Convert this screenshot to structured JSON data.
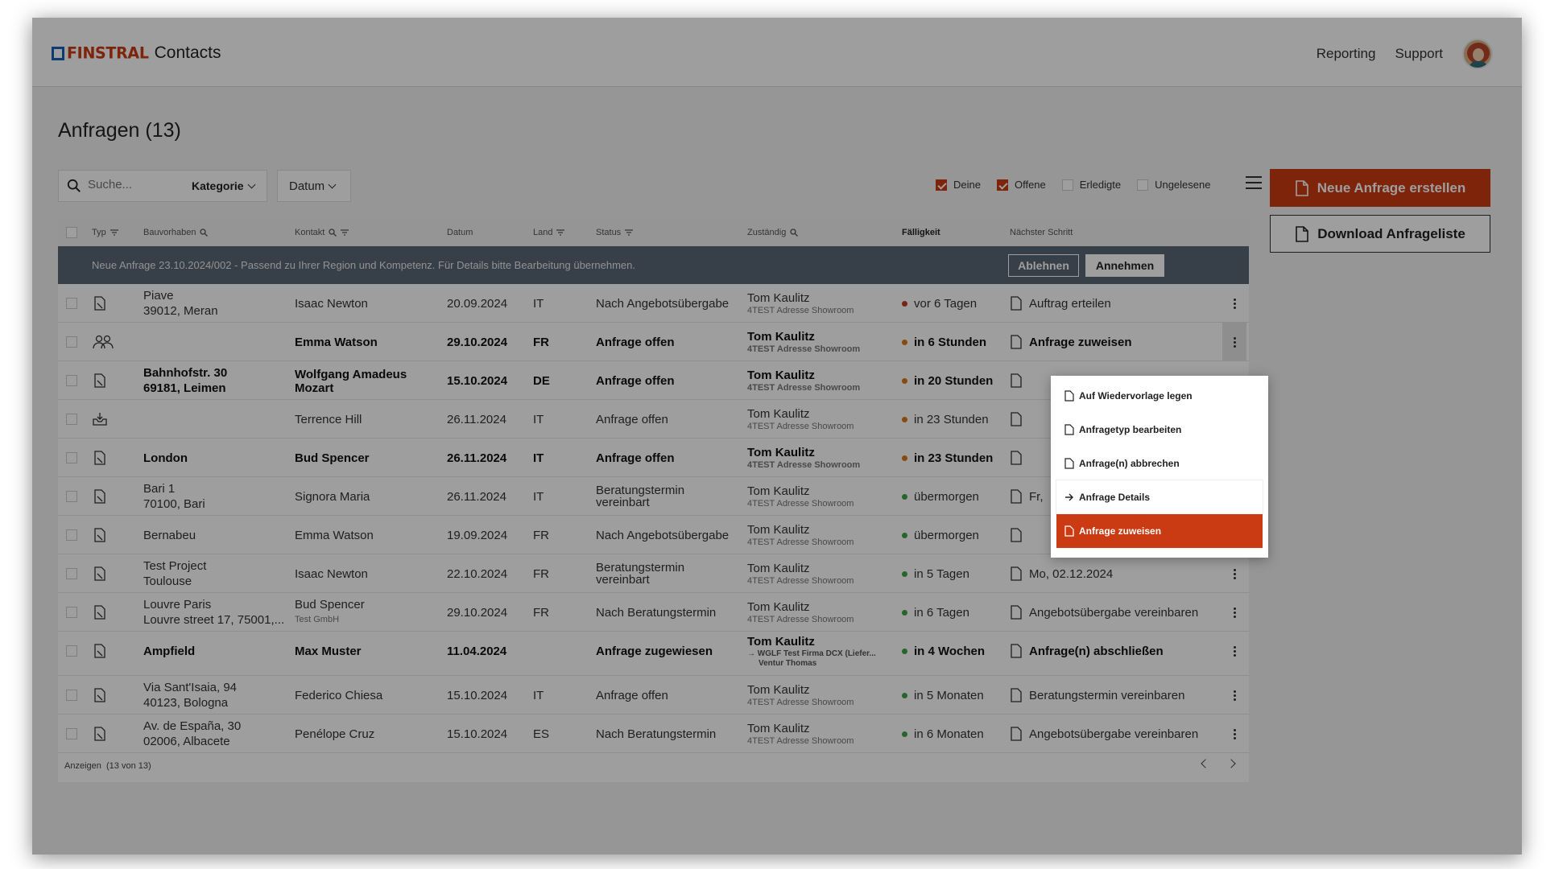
{
  "app": {
    "brand": "FINSTRAL",
    "product": "Contacts"
  },
  "topnav": {
    "reporting": "Reporting",
    "support": "Support"
  },
  "page": {
    "title": "Anfragen (13)"
  },
  "filterbar": {
    "search_placeholder": "Suche...",
    "category": "Kategorie",
    "date": "Datum",
    "filters": [
      {
        "label": "Deine",
        "checked": true
      },
      {
        "label": "Offene",
        "checked": true
      },
      {
        "label": "Erledigte",
        "checked": false
      },
      {
        "label": "Ungelesene",
        "checked": false
      }
    ]
  },
  "actions": {
    "new": "Neue Anfrage erstellen",
    "download": "Download Anfrageliste"
  },
  "table": {
    "headers": {
      "typ": "Typ",
      "bauvorhaben": "Bauvorhaben",
      "kontakt": "Kontakt",
      "datum": "Datum",
      "land": "Land",
      "status": "Status",
      "zustaendig": "Zuständig",
      "faelligkeit": "Fälligkeit",
      "next": "Nächster Schritt"
    },
    "banner": {
      "text": "Neue Anfrage 23.10.2024/002 - Passend zu Ihrer Region und Kompetenz. Für Details bitte Bearbeitung übernehmen.",
      "decline": "Ablehnen",
      "accept": "Annehmen"
    },
    "rows": [
      {
        "bold": false,
        "bau1": "Piave",
        "bau2": "39012, Meran",
        "kontakt": "Isaac Newton",
        "kontakt_sub": "",
        "datum": "20.09.2024",
        "land": "IT",
        "status1": "Nach Angebotsübergabe",
        "status2": "",
        "zust": "Tom Kaulitz",
        "zust_sub": "4TEST Adresse Showroom",
        "zust_sub2": "",
        "faell": "vor 6 Tagen",
        "dot": "red",
        "next": "Auftrag erteilen"
      },
      {
        "bold": true,
        "active": true,
        "bau1": "",
        "bau2": "",
        "kontakt": "Emma Watson",
        "kontakt_sub": "",
        "datum": "29.10.2024",
        "land": "FR",
        "status1": "Anfrage offen",
        "status2": "",
        "zust": "Tom Kaulitz",
        "zust_sub": "4TEST Adresse Showroom",
        "zust_sub2": "",
        "faell": "in 6 Stunden",
        "dot": "orange",
        "next": "Anfrage zuweisen"
      },
      {
        "bold": true,
        "bau1": "Bahnhofstr. 30",
        "bau2": "69181, Leimen",
        "kontakt": "Wolfgang Amadeus",
        "kontakt2": "Mozart",
        "kontakt_sub": "",
        "datum": "15.10.2024",
        "land": "DE",
        "status1": "Anfrage offen",
        "status2": "",
        "zust": "Tom Kaulitz",
        "zust_sub": "4TEST Adresse Showroom",
        "zust_sub2": "",
        "faell": "in 20 Stunden",
        "dot": "orange",
        "next": ""
      },
      {
        "bold": false,
        "bau1": "",
        "bau2": "",
        "kontakt": "Terrence Hill",
        "kontakt_sub": "",
        "datum": "26.11.2024",
        "land": "IT",
        "status1": "Anfrage offen",
        "status2": "",
        "zust": "Tom Kaulitz",
        "zust_sub": "4TEST Adresse Showroom",
        "zust_sub2": "",
        "faell": "in 23 Stunden",
        "dot": "orange",
        "next": ""
      },
      {
        "bold": true,
        "bau1": "London",
        "bau2": "",
        "kontakt": "Bud Spencer",
        "kontakt_sub": "",
        "datum": "26.11.2024",
        "land": "IT",
        "status1": "Anfrage offen",
        "status2": "",
        "zust": "Tom Kaulitz",
        "zust_sub": "4TEST Adresse Showroom",
        "zust_sub2": "",
        "faell": "in 23 Stunden",
        "dot": "orange",
        "next": ""
      },
      {
        "bold": false,
        "bau1": "Bari 1",
        "bau2": "70100, Bari",
        "kontakt": "Signora Maria",
        "kontakt_sub": "",
        "datum": "26.11.2024",
        "land": "IT",
        "status1": "Beratungstermin",
        "status2": "vereinbart",
        "zust": "Tom Kaulitz",
        "zust_sub": "4TEST Adresse Showroom",
        "zust_sub2": "",
        "faell": "übermorgen",
        "dot": "green",
        "next": "Fr,"
      },
      {
        "bold": false,
        "bau1": "Bernabeu",
        "bau2": "",
        "kontakt": "Emma Watson",
        "kontakt_sub": "",
        "datum": "19.09.2024",
        "land": "FR",
        "status1": "Nach Angebotsübergabe",
        "status2": "",
        "zust": "Tom Kaulitz",
        "zust_sub": "4TEST Adresse Showroom",
        "zust_sub2": "",
        "faell": "übermorgen",
        "dot": "green",
        "next": ""
      },
      {
        "bold": false,
        "bau1": "Test Project",
        "bau2": "Toulouse",
        "kontakt": "Isaac Newton",
        "kontakt_sub": "",
        "datum": "22.10.2024",
        "land": "FR",
        "status1": "Beratungstermin",
        "status2": "vereinbart",
        "zust": "Tom Kaulitz",
        "zust_sub": "4TEST Adresse Showroom",
        "zust_sub2": "",
        "faell": "in 5 Tagen",
        "dot": "green",
        "next": "Mo, 02.12.2024"
      },
      {
        "bold": false,
        "bau1": "Louvre Paris",
        "bau2": "Louvre street 17, 75001,...",
        "kontakt": "Bud Spencer",
        "kontakt_sub": "Test GmbH",
        "datum": "29.10.2024",
        "land": "FR",
        "status1": "Nach Beratungstermin",
        "status2": "",
        "zust": "Tom Kaulitz",
        "zust_sub": "4TEST Adresse Showroom",
        "zust_sub2": "",
        "faell": "in 6 Tagen",
        "dot": "green",
        "next": "Angebotsübergabe vereinbaren"
      },
      {
        "bold": true,
        "bau1": "Ampfield",
        "bau2": "",
        "kontakt": "Max Muster",
        "kontakt_sub": "",
        "datum": "11.04.2024",
        "land": "",
        "status1": "Anfrage zugewiesen",
        "status2": "",
        "zust": "Tom Kaulitz",
        "zust_sub": "",
        "zust_sub2": "→ WGLF Test Firma DCX (Liefer...",
        "zust_sub3": "Ventur Thomas",
        "faell": "in 4 Wochen",
        "dot": "green",
        "next": "Anfrage(n) abschließen"
      },
      {
        "bold": false,
        "bau1": "Via Sant'Isaia, 94",
        "bau2": "40123, Bologna",
        "kontakt": "Federico Chiesa",
        "kontakt_sub": "",
        "datum": "15.10.2024",
        "land": "IT",
        "status1": "Anfrage offen",
        "status2": "",
        "zust": "Tom Kaulitz",
        "zust_sub": "4TEST Adresse Showroom",
        "zust_sub2": "",
        "faell": "in 5 Monaten",
        "dot": "green",
        "next": "Beratungstermin vereinbaren"
      },
      {
        "bold": false,
        "bau1": "Av. de España, 30",
        "bau2": "02006, Albacete",
        "kontakt": "Penélope Cruz",
        "kontakt_sub": "",
        "datum": "15.10.2024",
        "land": "ES",
        "status1": "Nach Beratungstermin",
        "status2": "",
        "zust": "Tom Kaulitz",
        "zust_sub": "4TEST Adresse Showroom",
        "zust_sub2": "",
        "faell": "in 6 Monaten",
        "dot": "green",
        "next": "Angebotsübergabe vereinbaren"
      }
    ],
    "footer": {
      "label": "Anzeigen",
      "count": "(13 von 13)"
    }
  },
  "context_menu": {
    "items": [
      {
        "label": "Auf Wiedervorlage legen",
        "state": ""
      },
      {
        "label": "Anfragetyp bearbeiten",
        "state": ""
      },
      {
        "label": "Anfrage(n) abbrechen",
        "state": ""
      },
      {
        "label": "Anfrage Details",
        "state": "hov",
        "arrow": true
      },
      {
        "label": "Anfrage zuweisen",
        "state": "sel"
      }
    ]
  },
  "colors": {
    "accent": "#ca3a13",
    "brand_blue": "#1560b8",
    "banner": "#5a6776"
  }
}
